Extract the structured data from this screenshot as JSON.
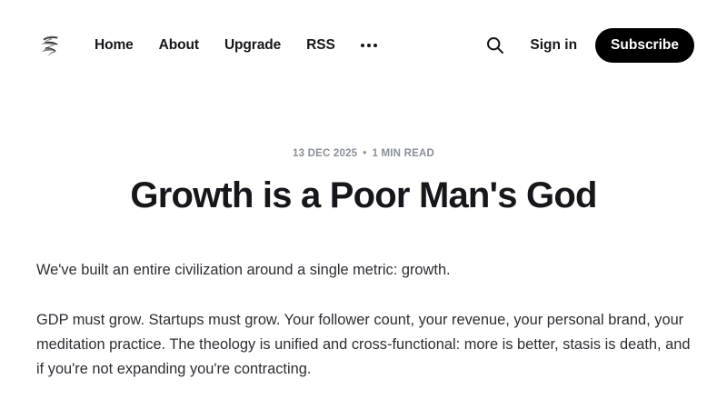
{
  "header": {
    "logo_icon": "brush-stroke-logo-icon",
    "nav": {
      "items": [
        {
          "label": "Home"
        },
        {
          "label": "About"
        },
        {
          "label": "Upgrade"
        },
        {
          "label": "RSS"
        }
      ],
      "more_icon": "ellipsis-icon"
    },
    "search_icon": "search-icon",
    "signin_label": "Sign in",
    "subscribe_label": "Subscribe"
  },
  "article": {
    "date": "13 DEC 2025",
    "separator": "•",
    "read_time": "1 MIN READ",
    "title": "Growth is a Poor Man's God",
    "paragraphs": [
      "We've built an entire civilization around a single metric: growth.",
      "GDP must grow. Startups must grow. Your follower count, your revenue, your personal brand, your meditation practice. The theology is unified and cross-functional: more is better, stasis is death, and if you're not expanding you're contracting."
    ]
  },
  "colors": {
    "text": "#15171a",
    "meta": "#8a8f98",
    "button_bg": "#000000",
    "button_text": "#ffffff",
    "background": "#ffffff"
  }
}
